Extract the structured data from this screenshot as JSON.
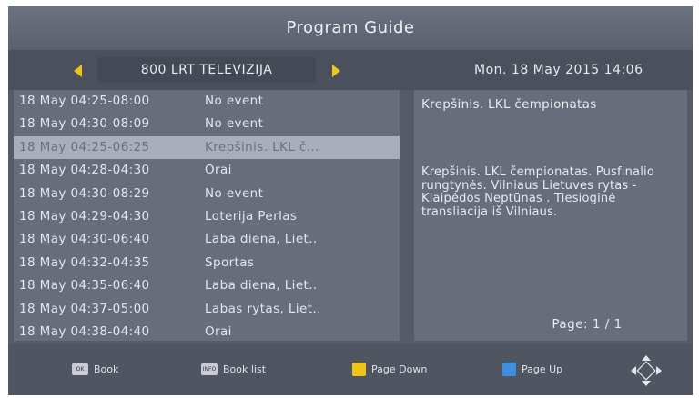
{
  "header": {
    "title": "Program Guide"
  },
  "channel_bar": {
    "channel_name": "800 LRT TELEVIZIJA",
    "date_time": "Mon.   18 May 2015 14:06",
    "accent_color": "#f2c418"
  },
  "events": [
    {
      "time": "18 May 04:25-08:00",
      "title": "No event",
      "selected": false
    },
    {
      "time": "18 May 04:30-08:09",
      "title": "No event",
      "selected": false
    },
    {
      "time": "18 May 04:25-06:25",
      "title": "Krepšinis. LKL č...",
      "selected": true
    },
    {
      "time": "18 May 04:28-04:30",
      "title": "Orai",
      "selected": false
    },
    {
      "time": "18 May 04:30-08:29",
      "title": "No event",
      "selected": false
    },
    {
      "time": "18 May 04:29-04:30",
      "title": "Loterija Perlas",
      "selected": false
    },
    {
      "time": "18 May 04:30-06:40",
      "title": "Laba diena, Liet..",
      "selected": false
    },
    {
      "time": "18 May 04:32-04:35",
      "title": "Sportas",
      "selected": false
    },
    {
      "time": "18 May 04:35-06:40",
      "title": "Laba diena, Liet..",
      "selected": false
    },
    {
      "time": "18 May 04:37-05:00",
      "title": "Labas rytas, Liet..",
      "selected": false
    },
    {
      "time": "18 May 04:38-04:40",
      "title": "Orai",
      "selected": false
    }
  ],
  "detail": {
    "title": "Krepšinis. LKL čempionatas",
    "description": "Krepšinis. LKL čempionatas. Pusfinalio rungtynės. Vilniaus Lietuves rytas - Klaipėdos Neptūnas . Tiesioginė transliacija iš Vilniaus.",
    "page": "Page:  1 / 1"
  },
  "footer": {
    "ok_key": "OK",
    "ok_label": "Book",
    "info_key": "INFO",
    "book_list_label": "Book list",
    "page_down_label": "Page Down",
    "page_up_label": "Page Up",
    "page_down_color": "#f0c419",
    "page_up_color": "#3f8fe0"
  }
}
